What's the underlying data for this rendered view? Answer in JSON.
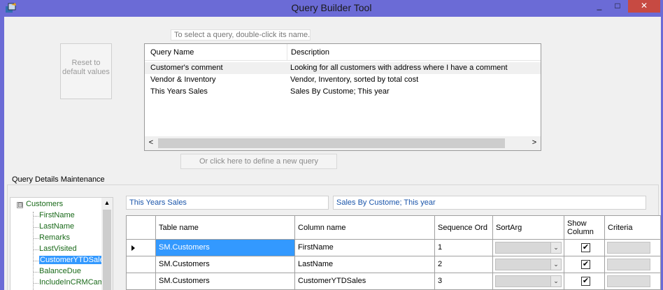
{
  "window": {
    "title": "Query Builder Tool",
    "minimize": "_",
    "maximize": "□",
    "close": "✕"
  },
  "colors": {
    "titlebar": "#6b6bd6",
    "close": "#c74a42",
    "selection": "#3399ff",
    "tree_text": "#1a6a1a",
    "field_text": "#1a55aa"
  },
  "query_list": {
    "hint": "To select a query, double-click its name.",
    "columns": {
      "name": "Query Name",
      "description": "Description"
    },
    "rows": [
      {
        "name": "Customer's comment",
        "description": "Looking for all customers with address where I have a comment"
      },
      {
        "name": "Vendor & Inventory",
        "description": "Vendor, Inventory, sorted by total cost"
      },
      {
        "name": "This Years Sales",
        "description": "Sales By Custome; This year"
      }
    ],
    "scroll_left": "<",
    "scroll_right": ">"
  },
  "reset_button": {
    "label": "Reset to default values"
  },
  "new_query_button": {
    "label": "Or click here to define a new query"
  },
  "details": {
    "group_title": "Query Details Maintenance",
    "query_name": "This Years Sales",
    "query_description": "Sales By Custome; This year",
    "tree": {
      "root": "Customers",
      "expander": "⊟",
      "scroll_up": "▲",
      "children": [
        "FirstName",
        "LastName",
        "Remarks",
        "LastVisited",
        "CustomerYTDSales",
        "BalanceDue",
        "IncludeInCRMCampaign"
      ],
      "selected_index": 4
    },
    "grid": {
      "columns": {
        "table": "Table name",
        "column": "Column name",
        "seq": "Sequence Ord",
        "sort": "SortArg",
        "show": "Show Column",
        "criteria": "Criteria"
      },
      "rows": [
        {
          "table": "SM.Customers",
          "column": "FirstName",
          "seq": "1",
          "show": true
        },
        {
          "table": "SM.Customers",
          "column": "LastName",
          "seq": "2",
          "show": true
        },
        {
          "table": "SM.Customers",
          "column": "CustomerYTDSales",
          "seq": "3",
          "show": true
        }
      ],
      "combo_arrow": "⌄",
      "check_mark": "✔"
    }
  }
}
